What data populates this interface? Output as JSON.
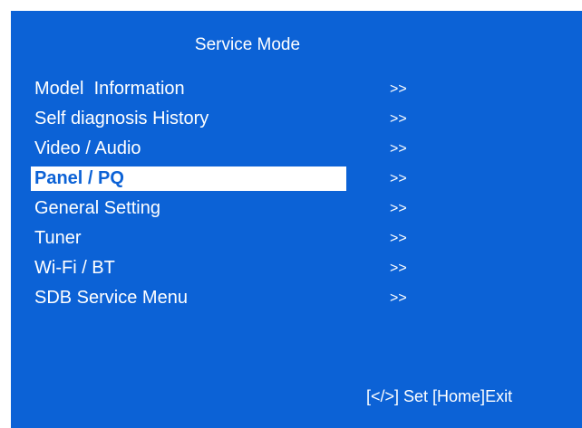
{
  "title": "Service Mode",
  "menu": {
    "items": [
      {
        "label": "Model  Information",
        "arrow": ">>"
      },
      {
        "label": "Self diagnosis History",
        "arrow": ">>"
      },
      {
        "label": "Video / Audio",
        "arrow": ">>"
      },
      {
        "label": "Panel / PQ",
        "arrow": ">>",
        "selected": true
      },
      {
        "label": "General Setting",
        "arrow": ">>"
      },
      {
        "label": "Tuner",
        "arrow": ">>"
      },
      {
        "label": "Wi-Fi / BT",
        "arrow": ">>"
      },
      {
        "label": "SDB Service Menu",
        "arrow": ">>"
      }
    ]
  },
  "footer": {
    "hint": "[</>] Set [Home]Exit"
  },
  "colors": {
    "background": "#0c62d6",
    "text": "#ffffff",
    "highlight": "#ffffff"
  }
}
